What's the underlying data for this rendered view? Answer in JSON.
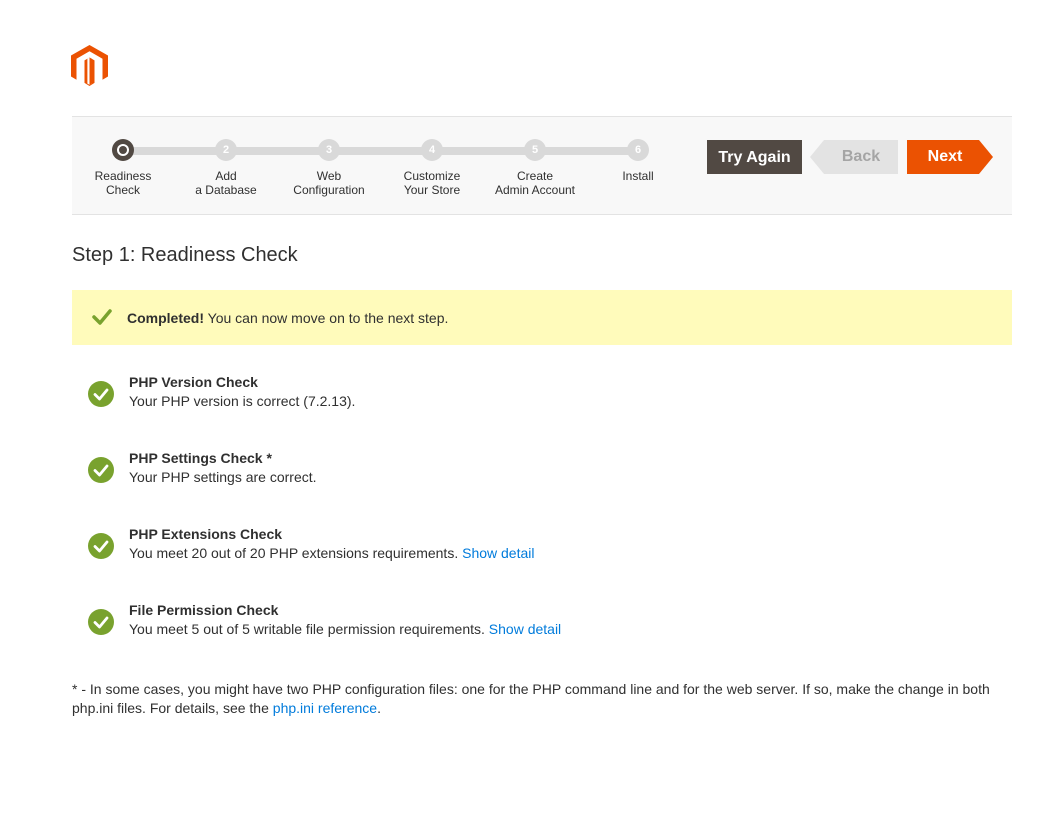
{
  "colors": {
    "brand": "#eb5202",
    "dark": "#514943",
    "success": "#79a22e",
    "link": "#007bdb",
    "banner": "#fffbbb"
  },
  "progress": {
    "steps": [
      {
        "number": "1",
        "line1": "Readiness",
        "line2": "Check",
        "active": true
      },
      {
        "number": "2",
        "line1": "Add",
        "line2": "a Database",
        "active": false
      },
      {
        "number": "3",
        "line1": "Web",
        "line2": "Configuration",
        "active": false
      },
      {
        "number": "4",
        "line1": "Customize",
        "line2": "Your Store",
        "active": false
      },
      {
        "number": "5",
        "line1": "Create",
        "line2": "Admin Account",
        "active": false
      },
      {
        "number": "6",
        "line1": "Install",
        "line2": "",
        "active": false
      }
    ],
    "buttons": {
      "try_again": "Try Again",
      "back": "Back",
      "next": "Next"
    }
  },
  "heading": "Step 1: Readiness Check",
  "banner": {
    "strong": "Completed!",
    "text": " You can now move on to the next step."
  },
  "checks": [
    {
      "title": "PHP Version Check",
      "desc": "Your PHP version is correct (7.2.13).",
      "link": ""
    },
    {
      "title": "PHP Settings Check *",
      "desc": "Your PHP settings are correct.",
      "link": ""
    },
    {
      "title": "PHP Extensions Check",
      "desc": "You meet 20 out of 20 PHP extensions requirements. ",
      "link": "Show detail"
    },
    {
      "title": "File Permission Check",
      "desc": "You meet 5 out of 5 writable file permission requirements. ",
      "link": "Show detail"
    }
  ],
  "footnote": {
    "text": "* - In some cases, you might have two PHP configuration files: one for the PHP command line and for the web server. If so, make the change in both php.ini files. For details, see the ",
    "link": "php.ini reference",
    "end": "."
  }
}
